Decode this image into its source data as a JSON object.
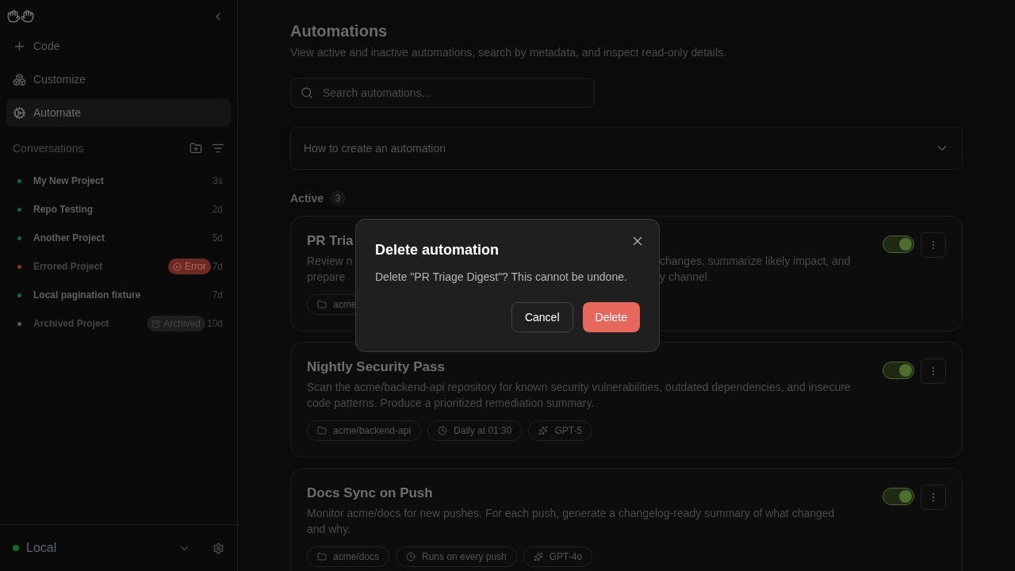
{
  "sidebar": {
    "nav": [
      {
        "label": "Code",
        "selected": false
      },
      {
        "label": "Customize",
        "selected": false
      },
      {
        "label": "Automate",
        "selected": true
      }
    ],
    "conversations_title": "Conversations",
    "conversations": [
      {
        "name": "My New Project",
        "time": "3s",
        "color": "#166c2c",
        "dimmed": false
      },
      {
        "name": "Repo Testing",
        "time": "2d",
        "color": "#166c2c",
        "dimmed": false
      },
      {
        "name": "Another Project",
        "time": "5d",
        "color": "#166c2c",
        "dimmed": false
      },
      {
        "name": "Errored Project",
        "time": "7d",
        "color": "#8a3328",
        "dimmed": true,
        "badge": {
          "kind": "error",
          "label": "Error"
        }
      },
      {
        "name": "Local pagination fixture",
        "time": "7d",
        "color": "#166c2c",
        "dimmed": false
      },
      {
        "name": "Archived Project",
        "time": "10d",
        "color": "#5a5a5a",
        "dimmed": true,
        "badge": {
          "kind": "archived",
          "label": "Archived"
        }
      }
    ],
    "environment": {
      "label": "Local",
      "color": "#0f6b2a"
    }
  },
  "page": {
    "title": "Automations",
    "subtitle": "View active and inactive automations, search by metadata, and inspect read-only details.",
    "search": {
      "placeholder": "Search automations..."
    },
    "accordion": {
      "label": "How to create an automation",
      "expanded": false
    },
    "section": {
      "label": "Active",
      "count": "3"
    },
    "cards": [
      {
        "title": "PR Tria",
        "description_left": [
          "Review n",
          "prepare"
        ],
        "description_right": [
          "changes, summarize likely impact, and",
          "y channel."
        ],
        "on": true,
        "tags": [
          {
            "kind": "repo",
            "label": "acme"
          }
        ]
      },
      {
        "title": "Nightly Security Pass",
        "description": "Scan the acme/backend-api repository for known security vulnerabilities, outdated dependencies, and insecure code patterns. Produce a prioritized remediation summary.",
        "on": true,
        "tags": [
          {
            "kind": "repo",
            "label": "acme/backend-api"
          },
          {
            "kind": "schedule",
            "label": "Daily at 01:30"
          },
          {
            "kind": "model",
            "label": "GPT-5"
          }
        ]
      },
      {
        "title": "Docs Sync on Push",
        "description": "Monitor acme/docs for new pushes. For each push, generate a changelog-ready summary of what changed and why.",
        "on": true,
        "tags": [
          {
            "kind": "repo",
            "label": "acme/docs"
          },
          {
            "kind": "schedule",
            "label": "Runs on every push"
          },
          {
            "kind": "model",
            "label": "GPT-4o"
          }
        ]
      }
    ]
  },
  "dialog": {
    "title": "Delete automation",
    "message": "Delete \"PR Triage Digest\"? This cannot be undone.",
    "cancel": "Cancel",
    "confirm": "Delete"
  }
}
